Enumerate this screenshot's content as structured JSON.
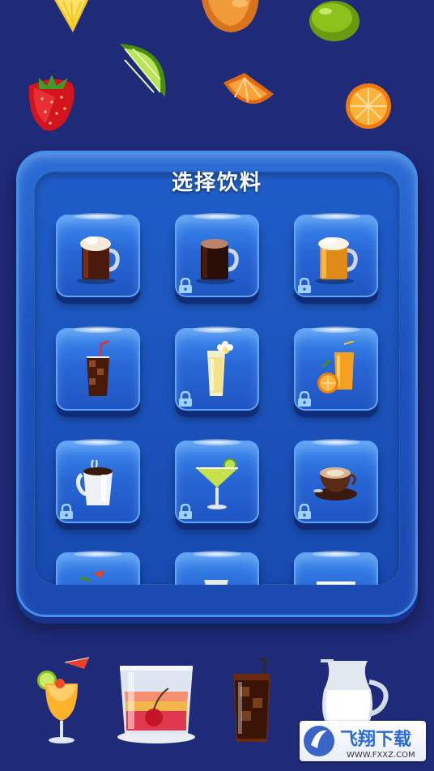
{
  "panel": {
    "title": "选择饮料"
  },
  "tiles": [
    {
      "icon": "dark-beer-mug-icon",
      "locked": false
    },
    {
      "icon": "stout-beer-mug-icon",
      "locked": true
    },
    {
      "icon": "lager-beer-mug-icon",
      "locked": true
    },
    {
      "icon": "cola-glass-icon",
      "locked": false
    },
    {
      "icon": "milkshake-glass-icon",
      "locked": true
    },
    {
      "icon": "orange-juice-icon",
      "locked": true
    },
    {
      "icon": "coffee-mug-icon",
      "locked": true
    },
    {
      "icon": "margarita-glass-icon",
      "locked": true
    },
    {
      "icon": "cappuccino-cup-icon",
      "locked": true
    },
    {
      "icon": "cocktail-umbrella-icon",
      "locked": false
    },
    {
      "icon": "milk-jug-icon",
      "locked": false
    },
    {
      "icon": "layered-drink-icon",
      "locked": false
    }
  ],
  "colors": {
    "background": "#1f2a78",
    "panel": "#1d54c0",
    "tile": "#2867d6"
  },
  "watermark": {
    "title": "飞翔下载",
    "url": "WWW.FXXZ.COM"
  }
}
